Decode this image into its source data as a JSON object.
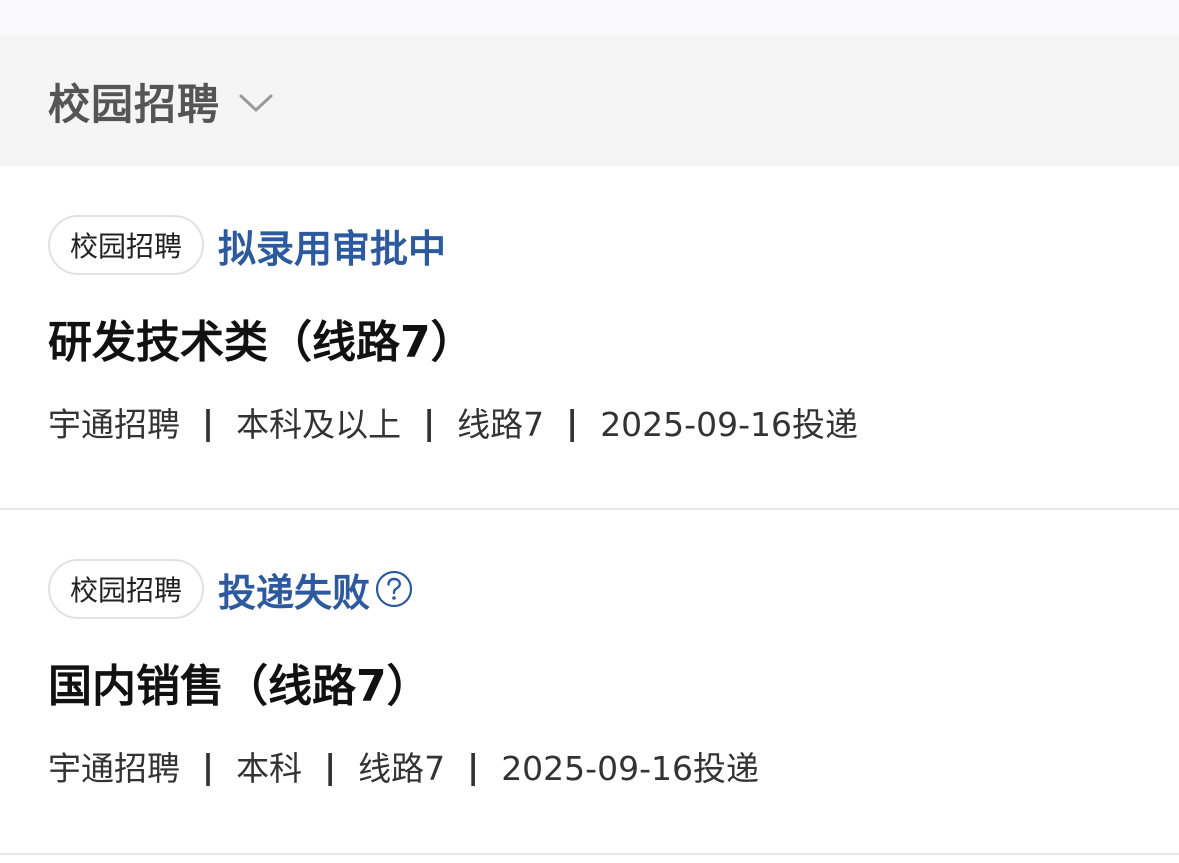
{
  "filter": {
    "label": "校园招聘",
    "icon": "chevron-down-icon"
  },
  "separator": "|",
  "applications": [
    {
      "tag": "校园招聘",
      "status": "拟录用审批中",
      "status_has_help": false,
      "title": "研发技术类（线路7）",
      "company": "宇通招聘",
      "education": "本科及以上",
      "route": "线路7",
      "date": "2025-09-16投递"
    },
    {
      "tag": "校园招聘",
      "status": "投递失败",
      "status_has_help": true,
      "title": "国内销售（线路7）",
      "company": "宇通招聘",
      "education": "本科",
      "route": "线路7",
      "date": "2025-09-16投递"
    }
  ],
  "colors": {
    "status": "#2d5a9e",
    "filter_bg": "#f5f5f5",
    "divider": "#e6e6e6"
  }
}
